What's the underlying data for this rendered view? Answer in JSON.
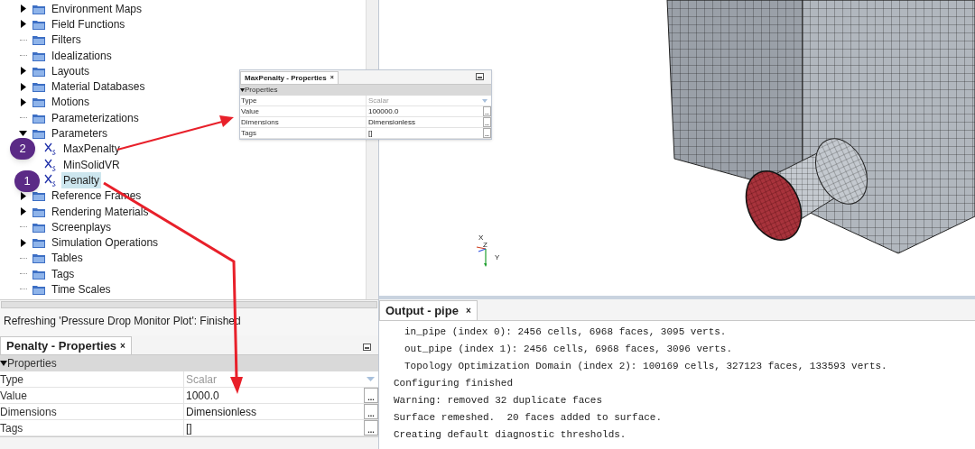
{
  "tree": {
    "items": [
      {
        "label": "Environment Maps",
        "expandable": true,
        "expanded": false
      },
      {
        "label": "Field Functions",
        "expandable": true,
        "expanded": false
      },
      {
        "label": "Filters",
        "expandable": false
      },
      {
        "label": "Idealizations",
        "expandable": false
      },
      {
        "label": "Layouts",
        "expandable": true,
        "expanded": false
      },
      {
        "label": "Material Databases",
        "expandable": true,
        "expanded": false
      },
      {
        "label": "Motions",
        "expandable": true,
        "expanded": false
      },
      {
        "label": "Parameterizations",
        "expandable": false
      },
      {
        "label": "Parameters",
        "expandable": true,
        "expanded": true,
        "children": [
          {
            "label": "MaxPenalty",
            "selected": false
          },
          {
            "label": "MinSolidVR",
            "selected": false
          },
          {
            "label": "Penalty",
            "selected": true
          }
        ]
      },
      {
        "label": "Reference Frames",
        "expandable": true,
        "expanded": false
      },
      {
        "label": "Rendering Materials",
        "expandable": true,
        "expanded": false
      },
      {
        "label": "Screenplays",
        "expandable": false
      },
      {
        "label": "Simulation Operations",
        "expandable": true,
        "expanded": false
      },
      {
        "label": "Tables",
        "expandable": false
      },
      {
        "label": "Tags",
        "expandable": false
      },
      {
        "label": "Time Scales",
        "expandable": false
      }
    ]
  },
  "status": {
    "message": "Refreshing 'Pressure Drop Monitor Plot': Finished"
  },
  "properties_panel": {
    "title": "Penalty - Properties",
    "close": "×",
    "section": "Properties",
    "rows": [
      {
        "name": "Type",
        "value": "Scalar",
        "kind": "dropdown"
      },
      {
        "name": "Value",
        "value": "1000.0",
        "kind": "button",
        "button": "..."
      },
      {
        "name": "Dimensions",
        "value": "Dimensionless",
        "kind": "button",
        "button": "..."
      },
      {
        "name": "Tags",
        "value": "[]",
        "kind": "button",
        "button": "..."
      }
    ]
  },
  "popup_properties": {
    "title": "MaxPenalty - Properties",
    "close": "×",
    "section": "Properties",
    "rows": [
      {
        "name": "Type",
        "value": "Scalar",
        "kind": "dropdown"
      },
      {
        "name": "Value",
        "value": "100000.0",
        "kind": "button",
        "button": "..."
      },
      {
        "name": "Dimensions",
        "value": "Dimensionless",
        "kind": "button",
        "button": "..."
      },
      {
        "name": "Tags",
        "value": "[]",
        "kind": "button",
        "button": "..."
      }
    ]
  },
  "viewport": {
    "axes": [
      "X",
      "Z",
      "Y"
    ]
  },
  "output": {
    "title": "Output - pipe",
    "close": "×",
    "lines": [
      {
        "text": "in_pipe (index 0): 2456 cells, 6968 faces, 3095 verts.",
        "indented": true
      },
      {
        "text": "out_pipe (index 1): 2456 cells, 6968 faces, 3096 verts.",
        "indented": true
      },
      {
        "text": "Topology Optimization Domain (index 2): 100169 cells, 327123 faces, 133593 verts.",
        "indented": true
      },
      {
        "text": "Configuring finished",
        "indented": false
      },
      {
        "text": "Warning: removed 32 duplicate faces",
        "indented": false
      },
      {
        "text": "Surface remeshed.  20 faces added to surface.",
        "indented": false
      },
      {
        "text": "Creating default diagnostic thresholds.",
        "indented": false
      }
    ]
  },
  "callouts": [
    {
      "number": "2"
    },
    {
      "number": "1"
    }
  ]
}
